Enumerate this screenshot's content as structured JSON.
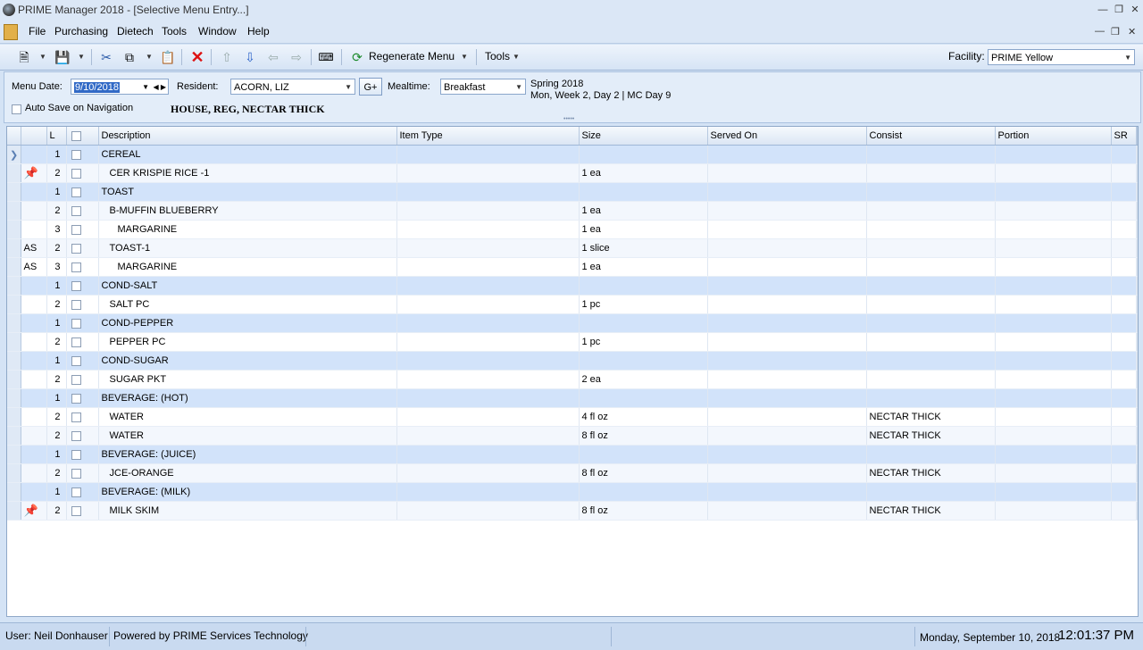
{
  "window": {
    "title": "PRIME Manager 2018 - [Selective Menu Entry...]"
  },
  "menu": [
    "File",
    "Purchasing",
    "Dietech",
    "Tools",
    "Window",
    "Help"
  ],
  "toolbar": {
    "regenerate_label": "Regenerate Menu",
    "tools_label": "Tools",
    "facility_label": "Facility:",
    "facility_value": "PRIME Yellow"
  },
  "form": {
    "menu_date_label": "Menu Date:",
    "menu_date_value": "9/10/2018",
    "resident_label": "Resident:",
    "resident_value": "ACORN, LIZ",
    "gplus_label": "G+",
    "mealtime_label": "Mealtime:",
    "mealtime_value": "Breakfast",
    "cycle_line1": "Spring 2018",
    "cycle_line2": "Mon, Week 2, Day 2 | MC Day 9",
    "autosave_label": "Auto Save on Navigation",
    "diet": "HOUSE, REG, NECTAR THICK"
  },
  "grid": {
    "columns": [
      "L",
      "Description",
      "Item Type",
      "Size",
      "Served On",
      "Consist",
      "Portion",
      "SR"
    ],
    "rows": [
      {
        "flag": "",
        "pin": false,
        "level": "1",
        "desc": "CEREAL",
        "item_type": "",
        "size": "",
        "served_on": "",
        "consist": "",
        "portion": "",
        "sr": ""
      },
      {
        "flag": "",
        "pin": true,
        "level": "2",
        "desc": "CER KRISPIE RICE -1",
        "item_type": "",
        "size": "1 ea",
        "served_on": "",
        "consist": "",
        "portion": "",
        "sr": ""
      },
      {
        "flag": "",
        "pin": false,
        "level": "1",
        "desc": "TOAST",
        "item_type": "",
        "size": "",
        "served_on": "",
        "consist": "",
        "portion": "",
        "sr": ""
      },
      {
        "flag": "",
        "pin": false,
        "level": "2",
        "desc": "B-MUFFIN BLUEBERRY",
        "item_type": "",
        "size": "1 ea",
        "served_on": "",
        "consist": "",
        "portion": "",
        "sr": ""
      },
      {
        "flag": "",
        "pin": false,
        "level": "3",
        "desc": "MARGARINE",
        "item_type": "",
        "size": "1 ea",
        "served_on": "",
        "consist": "",
        "portion": "",
        "sr": ""
      },
      {
        "flag": "AS",
        "pin": false,
        "level": "2",
        "desc": "TOAST-1",
        "item_type": "",
        "size": "1 slice",
        "served_on": "",
        "consist": "",
        "portion": "",
        "sr": ""
      },
      {
        "flag": "AS",
        "pin": false,
        "level": "3",
        "desc": "MARGARINE",
        "item_type": "",
        "size": "1 ea",
        "served_on": "",
        "consist": "",
        "portion": "",
        "sr": ""
      },
      {
        "flag": "",
        "pin": false,
        "level": "1",
        "desc": "COND-SALT",
        "item_type": "",
        "size": "",
        "served_on": "",
        "consist": "",
        "portion": "",
        "sr": ""
      },
      {
        "flag": "",
        "pin": false,
        "level": "2",
        "desc": "SALT PC",
        "item_type": "",
        "size": "1 pc",
        "served_on": "",
        "consist": "",
        "portion": "",
        "sr": ""
      },
      {
        "flag": "",
        "pin": false,
        "level": "1",
        "desc": "COND-PEPPER",
        "item_type": "",
        "size": "",
        "served_on": "",
        "consist": "",
        "portion": "",
        "sr": ""
      },
      {
        "flag": "",
        "pin": false,
        "level": "2",
        "desc": "PEPPER PC",
        "item_type": "",
        "size": "1 pc",
        "served_on": "",
        "consist": "",
        "portion": "",
        "sr": ""
      },
      {
        "flag": "",
        "pin": false,
        "level": "1",
        "desc": "COND-SUGAR",
        "item_type": "",
        "size": "",
        "served_on": "",
        "consist": "",
        "portion": "",
        "sr": ""
      },
      {
        "flag": "",
        "pin": false,
        "level": "2",
        "desc": "SUGAR PKT",
        "item_type": "",
        "size": "2 ea",
        "served_on": "",
        "consist": "",
        "portion": "",
        "sr": ""
      },
      {
        "flag": "",
        "pin": false,
        "level": "1",
        "desc": "BEVERAGE: (HOT)",
        "item_type": "",
        "size": "",
        "served_on": "",
        "consist": "",
        "portion": "",
        "sr": ""
      },
      {
        "flag": "",
        "pin": false,
        "level": "2",
        "desc": "WATER",
        "item_type": "",
        "size": "4 fl oz",
        "served_on": "",
        "consist": "NECTAR THICK",
        "portion": "",
        "sr": ""
      },
      {
        "flag": "",
        "pin": false,
        "level": "2",
        "desc": "WATER",
        "item_type": "",
        "size": "8 fl oz",
        "served_on": "",
        "consist": "NECTAR THICK",
        "portion": "",
        "sr": ""
      },
      {
        "flag": "",
        "pin": false,
        "level": "1",
        "desc": "BEVERAGE: (JUICE)",
        "item_type": "",
        "size": "",
        "served_on": "",
        "consist": "",
        "portion": "",
        "sr": ""
      },
      {
        "flag": "",
        "pin": false,
        "level": "2",
        "desc": "JCE-ORANGE",
        "item_type": "",
        "size": "8 fl oz",
        "served_on": "",
        "consist": "NECTAR THICK",
        "portion": "",
        "sr": ""
      },
      {
        "flag": "",
        "pin": false,
        "level": "1",
        "desc": "BEVERAGE: (MILK)",
        "item_type": "",
        "size": "",
        "served_on": "",
        "consist": "",
        "portion": "",
        "sr": ""
      },
      {
        "flag": "",
        "pin": true,
        "level": "2",
        "desc": "MILK SKIM",
        "item_type": "",
        "size": "8 fl oz",
        "served_on": "",
        "consist": "NECTAR THICK",
        "portion": "",
        "sr": ""
      }
    ]
  },
  "status": {
    "user": "User: Neil Donhauser",
    "powered": "Powered by PRIME Services Technology",
    "date": "Monday, September 10, 2018",
    "time": "12:01:37 PM"
  }
}
